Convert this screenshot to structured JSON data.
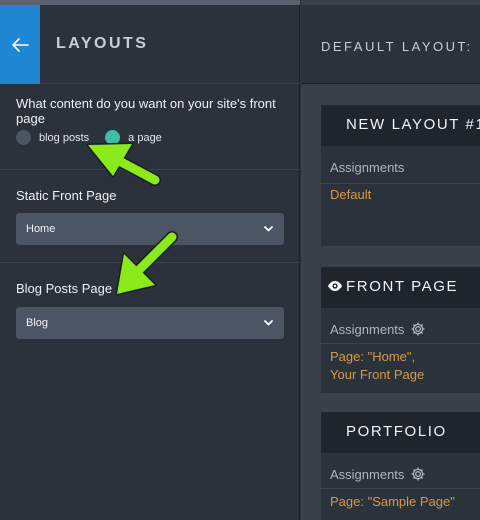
{
  "sidebar": {
    "title": "LAYOUTS",
    "question": "What content do you want on your site's front page",
    "radio_options": [
      {
        "label": "blog posts",
        "selected": false
      },
      {
        "label": "a page",
        "selected": true
      }
    ],
    "static_front_page": {
      "label": "Static Front Page",
      "value": "Home"
    },
    "blog_posts_page": {
      "label": "Blog Posts Page",
      "value": "Blog"
    }
  },
  "main": {
    "header_title": "DEFAULT LAYOUT:",
    "cards": [
      {
        "title": "NEW LAYOUT #1",
        "assignments_label": "Assignments",
        "value_lines": [
          "Default"
        ]
      },
      {
        "title": "FRONT PAGE",
        "assignments_label": "Assignments",
        "value_lines": [
          "Page: \"Home\",",
          "Your Front Page"
        ]
      },
      {
        "title": "PORTFOLIO",
        "assignments_label": "Assignments",
        "value_lines": [
          "Page: \"Sample Page\""
        ]
      }
    ]
  },
  "icons": {
    "back": "arrow-left-icon",
    "chevron": "chevron-down-icon",
    "eye": "eye-icon",
    "gear": "gear-icon"
  },
  "colors": {
    "accent_blue": "#1f86d3",
    "radio_selected": "#3fbda6",
    "link_orange": "#d69a45",
    "annotation_arrow": "#8bea1a"
  }
}
